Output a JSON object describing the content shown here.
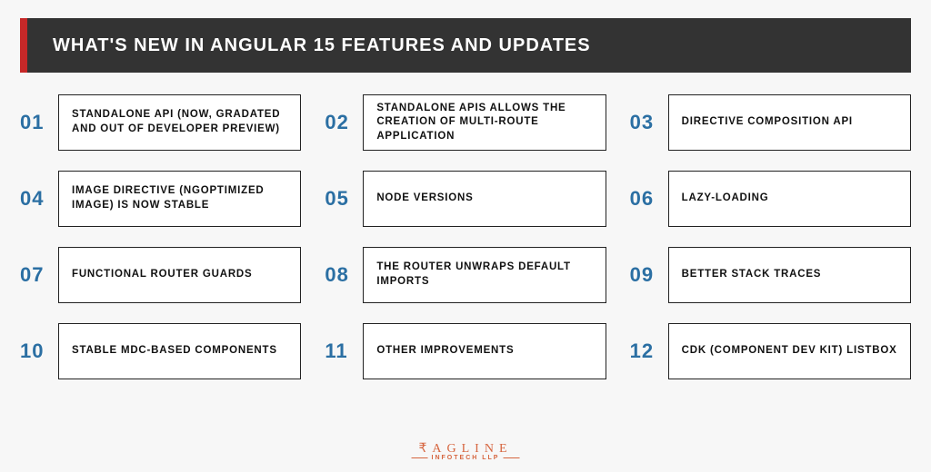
{
  "header": {
    "title": "WHAT'S NEW IN ANGULAR 15 FEATURES AND UPDATES"
  },
  "features": [
    {
      "num": "01",
      "label": "STANDALONE API (NOW, GRADATED AND OUT OF DEVELOPER PREVIEW)"
    },
    {
      "num": "02",
      "label": "STANDALONE APIS ALLOWS THE CREATION OF MULTI-ROUTE APPLICATION"
    },
    {
      "num": "03",
      "label": "DIRECTIVE COMPOSITION API"
    },
    {
      "num": "04",
      "label": "IMAGE DIRECTIVE (NGOPTIMIZED IMAGE) IS NOW STABLE"
    },
    {
      "num": "05",
      "label": "NODE VERSIONS"
    },
    {
      "num": "06",
      "label": "LAZY-LOADING"
    },
    {
      "num": "07",
      "label": "FUNCTIONAL ROUTER GUARDS"
    },
    {
      "num": "08",
      "label": "THE ROUTER UNWRAPS DEFAULT IMPORTS"
    },
    {
      "num": "09",
      "label": "BETTER STACK TRACES"
    },
    {
      "num": "10",
      "label": "STABLE MDC-BASED COMPONENTS"
    },
    {
      "num": "11",
      "label": "OTHER IMPROVEMENTS"
    },
    {
      "num": "12",
      "label": "CDK (COMPONENT DEV KIT) LISTBOX"
    }
  ],
  "footer": {
    "brand_top": "₹AGLINE",
    "brand_bottom": "INFOTECH LLP"
  }
}
